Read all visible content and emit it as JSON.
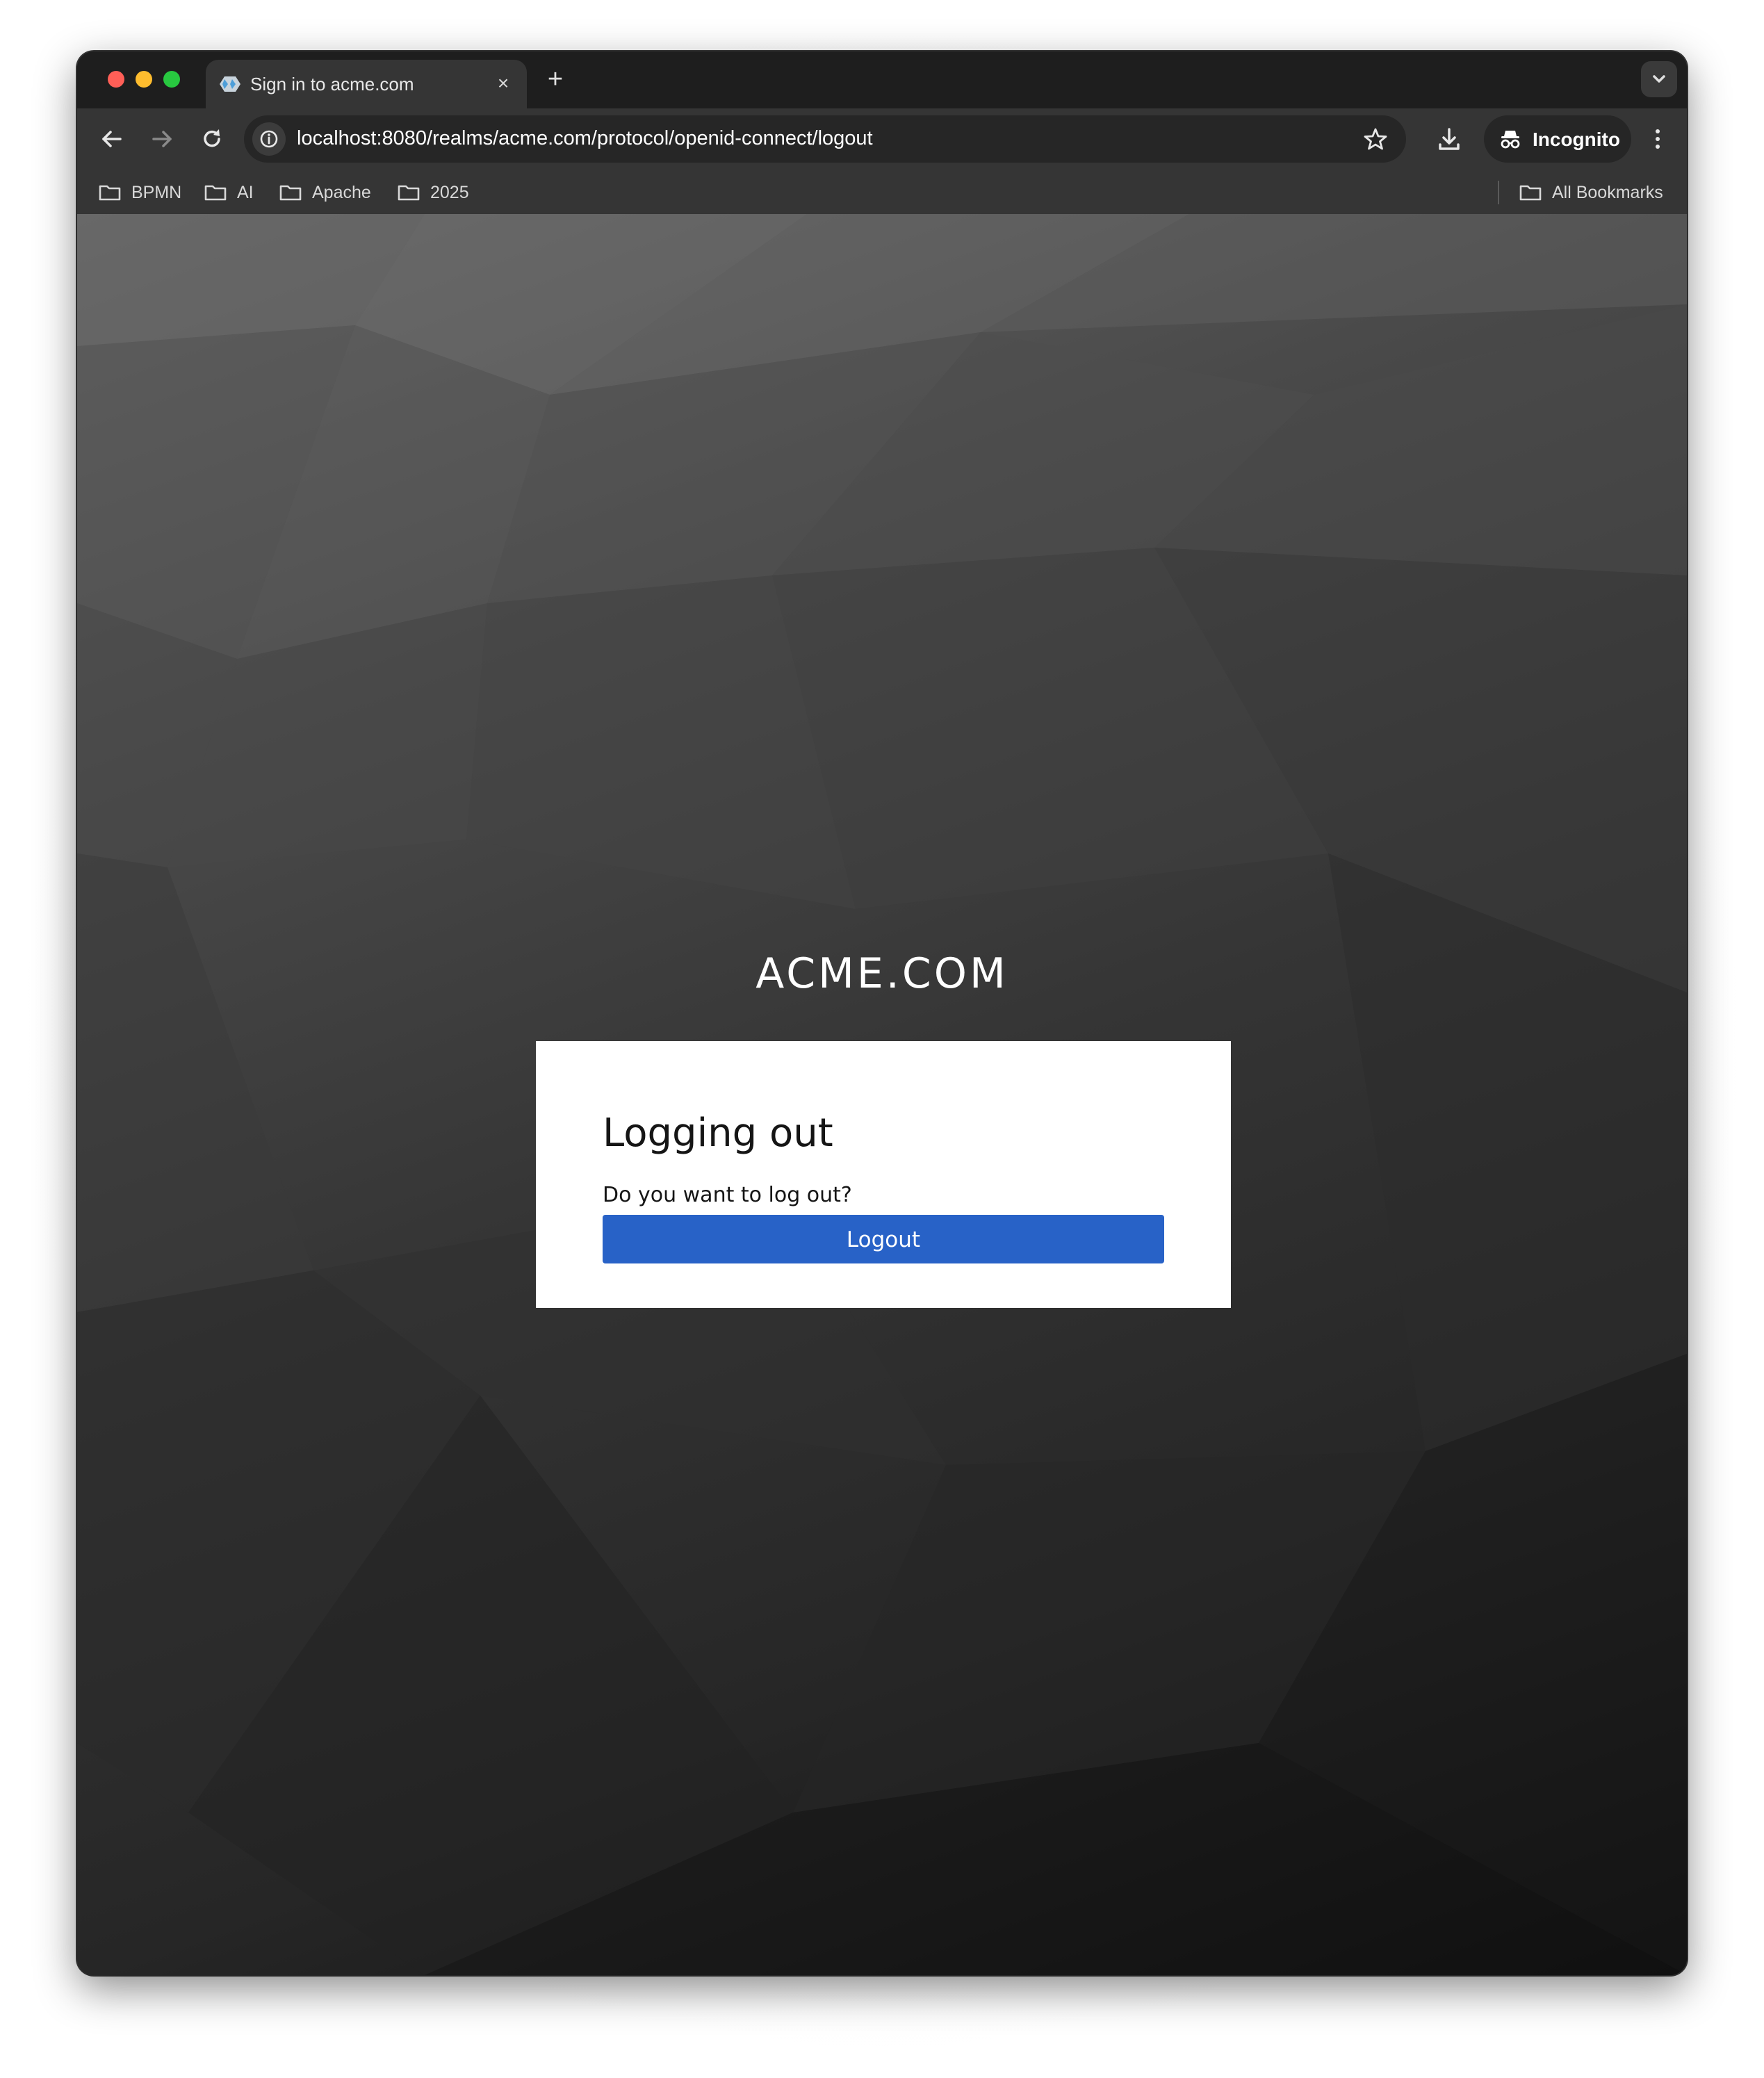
{
  "browser": {
    "tab": {
      "title": "Sign in to acme.com",
      "favicon": "keycloak-favicon-icon",
      "close_label": "×"
    },
    "new_tab_label": "+",
    "url": "localhost:8080/realms/acme.com/protocol/openid-connect/logout",
    "profile_label": "Incognito",
    "bookmarks": [
      {
        "label": "BPMN"
      },
      {
        "label": "AI"
      },
      {
        "label": "Apache"
      },
      {
        "label": "2025"
      }
    ],
    "all_bookmarks_label": "All Bookmarks"
  },
  "page": {
    "brand": "ACME.COM",
    "card": {
      "title": "Logging out",
      "message": "Do you want to log out?",
      "button_label": "Logout"
    }
  },
  "colors": {
    "button": "#2862c7",
    "card": "#ffffff",
    "browser_chrome": "#353535"
  }
}
